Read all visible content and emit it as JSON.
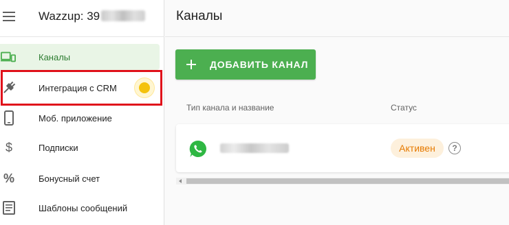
{
  "app": {
    "title": "Wazzup: 39"
  },
  "sidebar": {
    "items": [
      {
        "label": "Каналы",
        "icon": "devices-icon",
        "active": true
      },
      {
        "label": "Интеграция с CRM",
        "icon": "plug-icon",
        "active": false
      },
      {
        "label": "Моб. приложение",
        "icon": "phone-icon",
        "active": false
      },
      {
        "label": "Подписки",
        "icon": "dollar-icon",
        "active": false
      },
      {
        "label": "Бонусный счет",
        "icon": "percent-icon",
        "active": false
      },
      {
        "label": "Шаблоны сообщений",
        "icon": "document-icon",
        "active": false
      }
    ]
  },
  "main": {
    "title": "Каналы",
    "add_button": "ДОБАВИТЬ КАНАЛ",
    "table": {
      "headers": {
        "channel": "Тип канала и название",
        "status": "Статус"
      },
      "rows": [
        {
          "type_icon": "whatsapp-icon",
          "status": "Активен"
        }
      ]
    },
    "help_icon": "?"
  },
  "colors": {
    "primary": "#4caf50",
    "active_bg": "#e9f5e6",
    "status_text": "#e67a00",
    "status_bg": "#fdf0dc",
    "highlight": "#e0101a"
  }
}
